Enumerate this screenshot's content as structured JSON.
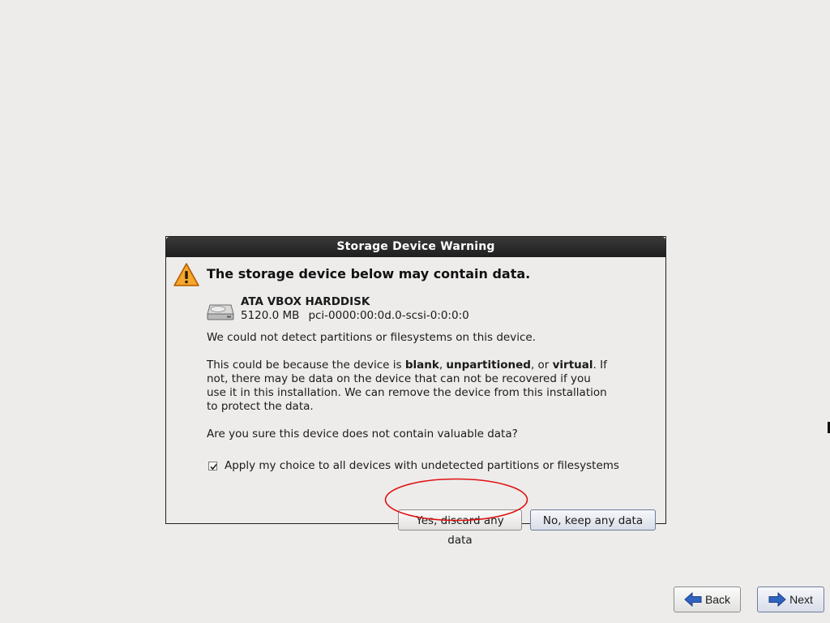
{
  "dialog": {
    "title": "Storage Device Warning",
    "heading": "The storage device below may contain data.",
    "device": {
      "name": "ATA VBOX HARDDISK",
      "size": "5120.0 MB",
      "path": "pci-0000:00:0d.0-scsi-0:0:0:0"
    },
    "paragraph1": "We could not detect partitions or filesystems on this device.",
    "paragraph2": {
      "prefix": "This could be because the device is ",
      "blank": "blank",
      "sep1": ", ",
      "unpartitioned": "unpartitioned",
      "sep2": ", or ",
      "virtual": "virtual",
      "suffix": ". If not, there may be data on the device that can not be recovered if you use it in this installation. We can remove the device from this installation to protect the data."
    },
    "paragraph3": "Are you sure this device does not contain valuable data?",
    "apply_all": {
      "label": "Apply my choice to all devices with undetected partitions or filesystems",
      "checked": true
    },
    "yes_button": "Yes, discard any data",
    "no_button": "No, keep any data"
  },
  "navigation": {
    "back_label": "Back",
    "next_label": "Next"
  },
  "icons": {
    "warning": "warning-triangle-icon",
    "disk": "hard-disk-icon",
    "back": "arrow-left-icon",
    "next": "arrow-right-icon"
  },
  "colors": {
    "background": "#edeceb",
    "titlebar": "#1e1e1e",
    "warning": "#f08a00",
    "annotation": "#e01010",
    "arrow": "#2f5fb3"
  }
}
